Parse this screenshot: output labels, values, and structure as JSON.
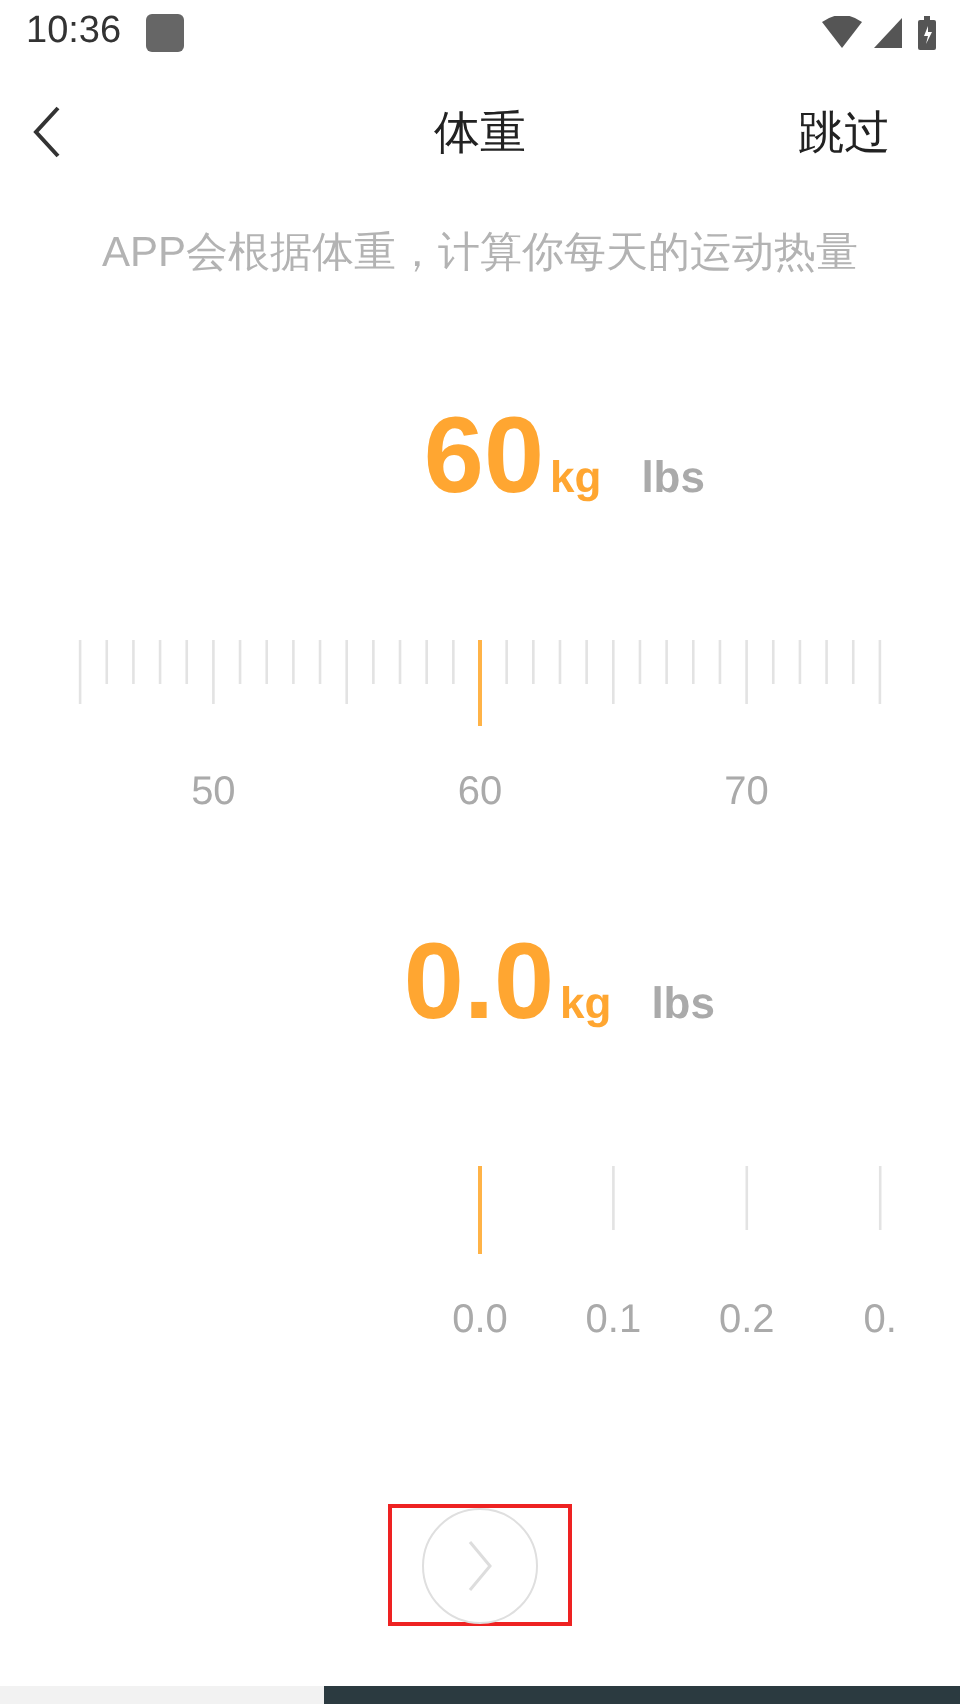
{
  "status_bar": {
    "time": "10:36"
  },
  "header": {
    "title": "体重",
    "skip": "跳过"
  },
  "subtitle": "APP会根据体重，计算你每天的运动热量",
  "pickers": [
    {
      "kind": "scale",
      "value": "60",
      "units": [
        {
          "label": "kg",
          "selected": true
        },
        {
          "label": "lbs",
          "selected": false
        }
      ],
      "labels": [
        "50",
        "60",
        "70"
      ]
    },
    {
      "kind": "decimal",
      "value": "0.0",
      "units": [
        {
          "label": "kg",
          "selected": true
        },
        {
          "label": "lbs",
          "selected": false
        }
      ],
      "labels": [
        "0.0",
        "0.1",
        "0.2",
        "0."
      ]
    }
  ],
  "next_button": {
    "highlighted": true
  }
}
